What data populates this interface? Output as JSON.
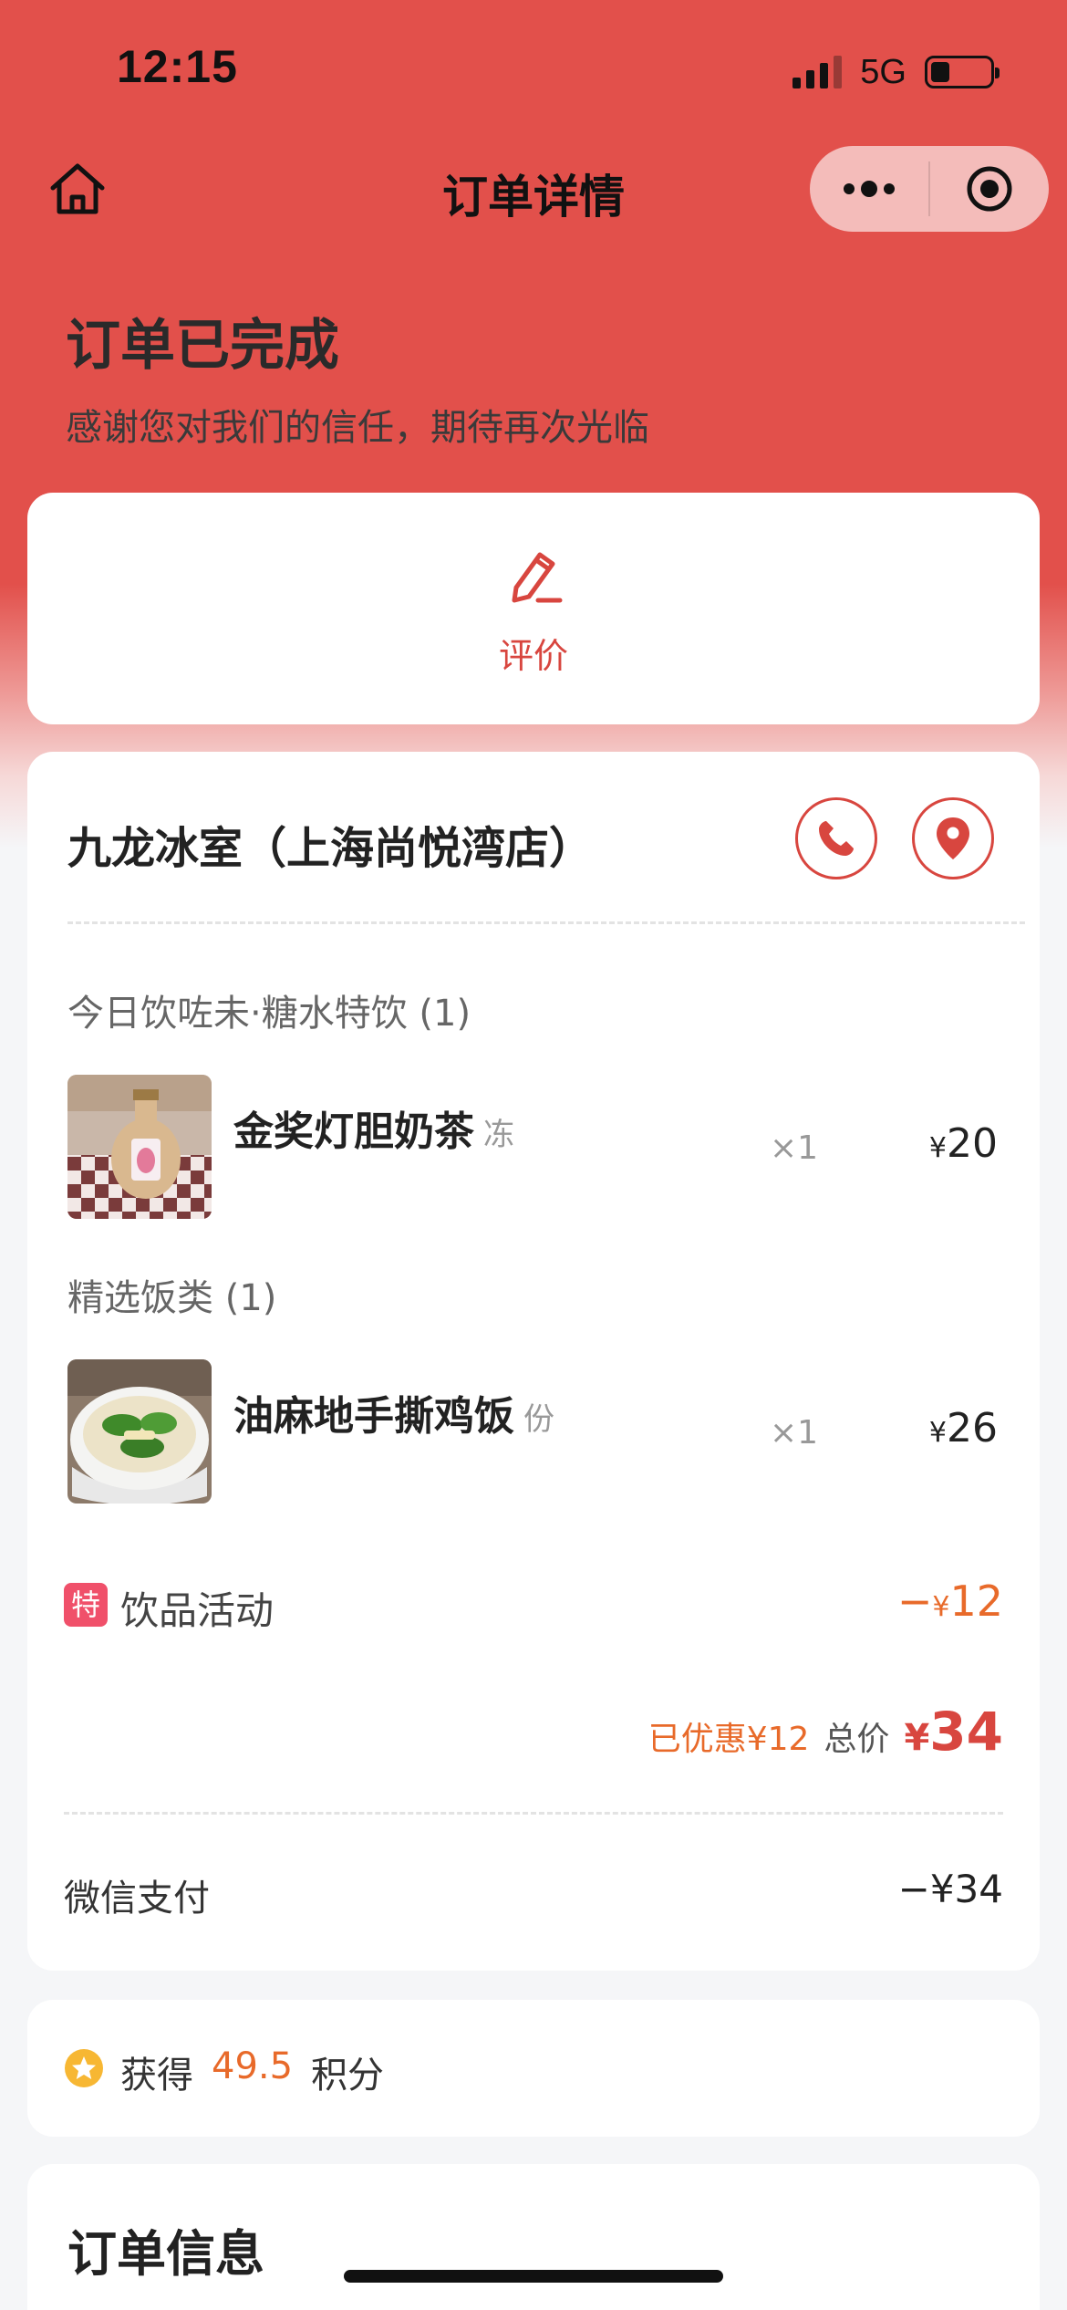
{
  "status_bar": {
    "time": "12:15",
    "network": "5G"
  },
  "nav": {
    "title": "订单详情"
  },
  "header": {
    "status": "订单已完成",
    "subtitle": "感谢您对我们的信任，期待再次光临"
  },
  "review": {
    "label": "评价"
  },
  "store": {
    "name": "九龙冰室（上海尚悦湾店）"
  },
  "categories": [
    {
      "title": "今日饮咗未·糖水特饮 (1)",
      "item": {
        "name": "金奖灯胆奶茶",
        "spec": "冻",
        "qty": "×1",
        "currency": "¥",
        "price": "20"
      }
    },
    {
      "title": "精选饭类 (1)",
      "item": {
        "name": "油麻地手撕鸡饭",
        "spec": "份",
        "qty": "×1",
        "currency": "¥",
        "price": "26"
      }
    }
  ],
  "promo": {
    "tag": "特",
    "label": "饮品活动",
    "sign": "−",
    "currency": "¥",
    "amount": "12"
  },
  "summary": {
    "saved": "已优惠¥12",
    "total_label": "总价",
    "currency": "¥",
    "total": "34"
  },
  "payment": {
    "label": "微信支付",
    "amount": "−¥34"
  },
  "points": {
    "prefix": "获得",
    "value": "49.5",
    "suffix": "积分"
  },
  "order_info": {
    "title": "订单信息"
  },
  "colors": {
    "primary_red": "#e2504b",
    "accent_orange": "#e86a2a",
    "tag_pink": "#f0506a"
  }
}
